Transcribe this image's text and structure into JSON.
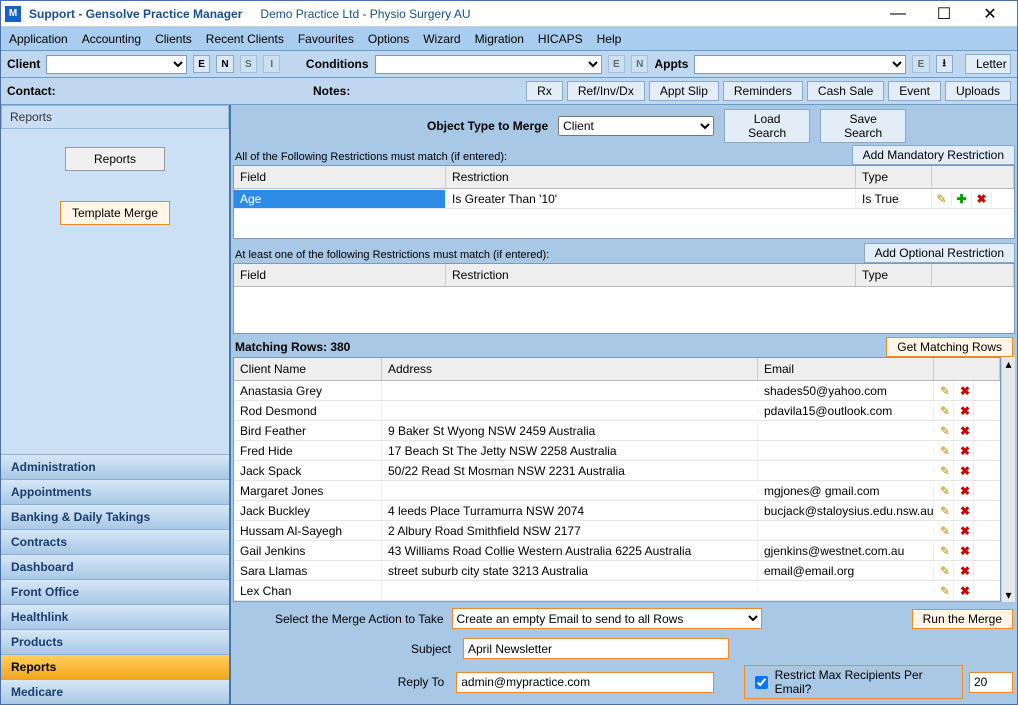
{
  "title": {
    "app": "Support - Gensolve Practice Manager",
    "company": "Demo Practice Ltd - Physio Surgery AU"
  },
  "win": {
    "min": "—",
    "max": "☐",
    "close": "✕"
  },
  "menu": [
    "Application",
    "Accounting",
    "Clients",
    "Recent Clients",
    "Favourites",
    "Options",
    "Wizard",
    "Migration",
    "HICAPS",
    "Help"
  ],
  "toolbar": {
    "client": "Client",
    "eb": "E",
    "nb": "N",
    "sb": "S",
    "ib": "I",
    "conditions": "Conditions",
    "eb2": "E",
    "nb2": "N",
    "appts": "Appts",
    "eb3": "E",
    "dlb": "⭳",
    "letter": "Letter"
  },
  "subbar": {
    "contact": "Contact:",
    "notes": "Notes:",
    "btns": {
      "rx": "Rx",
      "refinv": "Ref/Inv/Dx",
      "apptslip": "Appt Slip",
      "reminders": "Reminders",
      "cashsale": "Cash Sale",
      "event": "Event",
      "uploads": "Uploads"
    }
  },
  "sidebar": {
    "header": "Reports",
    "reportsBtn": "Reports",
    "templateMerge": "Template Merge",
    "nav": [
      "Administration",
      "Appointments",
      "Banking & Daily Takings",
      "Contracts",
      "Dashboard",
      "Front Office",
      "Healthlink",
      "Products",
      "Reports",
      "Medicare"
    ]
  },
  "mergeHeader": {
    "label": "Object Type to Merge",
    "value": "Client",
    "load": "Load Search",
    "save": "Save Search"
  },
  "mandatory": {
    "caption": "All of the Following Restrictions must match (if entered):",
    "addBtn": "Add Mandatory Restriction",
    "cols": {
      "field": "Field",
      "restriction": "Restriction",
      "type": "Type"
    },
    "row": {
      "field": "Age",
      "restriction": "Is Greater Than '10'",
      "type": "Is True"
    }
  },
  "optional": {
    "caption": "At least one of the following Restrictions must match (if entered):",
    "addBtn": "Add Optional Restriction",
    "cols": {
      "field": "Field",
      "restriction": "Restriction",
      "type": "Type"
    }
  },
  "matching": {
    "label": "Matching Rows: 380",
    "getBtn": "Get Matching Rows",
    "cols": {
      "name": "Client Name",
      "addr": "Address",
      "email": "Email"
    },
    "rows": [
      {
        "name": "Anastasia Grey",
        "addr": "",
        "email": "shades50@yahoo.com"
      },
      {
        "name": "Rod Desmond",
        "addr": "",
        "email": "pdavila15@outlook.com"
      },
      {
        "name": "Bird Feather",
        "addr": "9 Baker St Wyong NSW  2459 Australia",
        "email": ""
      },
      {
        "name": "Fred Hide",
        "addr": "17 Beach St The Jetty NSW  2258 Australia",
        "email": ""
      },
      {
        "name": "Jack Spack",
        "addr": "50/22 Read St Mosman NSW  2231 Australia",
        "email": ""
      },
      {
        "name": "Margaret Jones",
        "addr": "",
        "email": "mgjones@ gmail.com"
      },
      {
        "name": "Jack Buckley",
        "addr": "4 leeds Place Turramurra NSW  2074",
        "email": "bucjack@staloysius.edu.nsw.au"
      },
      {
        "name": "Hussam Al-Sayegh",
        "addr": "2 Albury Road Smithfield  NSW  2177",
        "email": ""
      },
      {
        "name": "Gail Jenkins",
        "addr": "43 Williams Road Collie Western Australia  6225 Australia",
        "email": "gjenkins@westnet.com.au"
      },
      {
        "name": "Sara Llamas",
        "addr": "street suburb city state  3213 Australia",
        "email": "email@email.org"
      },
      {
        "name": "Lex Chan",
        "addr": "",
        "email": ""
      }
    ]
  },
  "action": {
    "label": "Select the Merge Action to Take",
    "value": "Create an empty Email to send to all Rows",
    "run": "Run the Merge"
  },
  "form": {
    "subjectLabel": "Subject",
    "subject": "April Newsletter",
    "replyLabel": "Reply To",
    "reply": "admin@mypractice.com",
    "restrictLabel": "Restrict Max Recipients Per Email?",
    "restrictValue": "20"
  },
  "icons": {
    "edit": "✎",
    "del": "✖",
    "add": "✚",
    "up": "▴",
    "down": "▾"
  }
}
